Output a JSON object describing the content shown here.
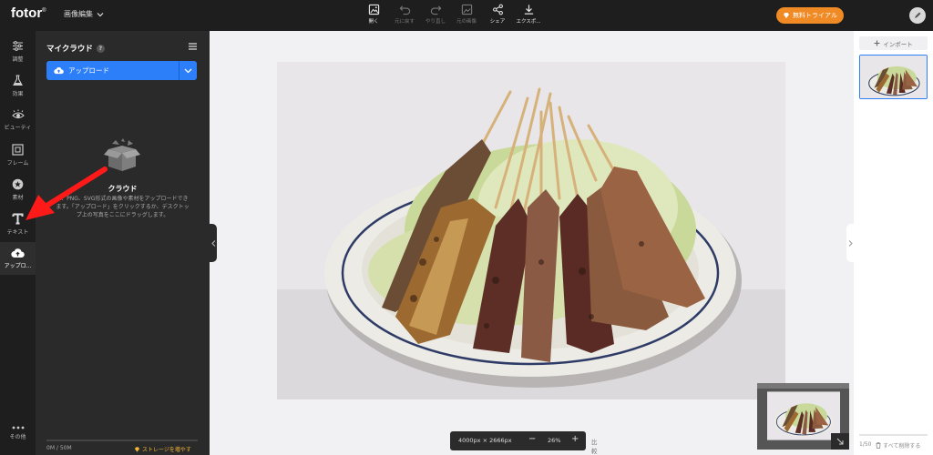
{
  "app": {
    "logo": "fotor",
    "logo_mark": "®",
    "mode_label": "画像編集",
    "trial_label": "無料トライアル"
  },
  "toolbar": [
    {
      "label": "開く",
      "icon": "image-open-icon",
      "enabled": true
    },
    {
      "label": "元に戻す",
      "icon": "undo-icon",
      "enabled": false
    },
    {
      "label": "やり直し",
      "icon": "redo-icon",
      "enabled": false
    },
    {
      "label": "元の画像",
      "icon": "original-image-icon",
      "enabled": false
    },
    {
      "label": "シェア",
      "icon": "share-icon",
      "enabled": true
    },
    {
      "label": "エクスポ...",
      "icon": "download-icon",
      "enabled": true
    }
  ],
  "sidebar": {
    "items": [
      {
        "label": "調整",
        "icon": "sliders-icon"
      },
      {
        "label": "効果",
        "icon": "flask-icon"
      },
      {
        "label": "ビューティ",
        "icon": "eye-icon"
      },
      {
        "label": "フレーム",
        "icon": "frame-icon"
      },
      {
        "label": "素材",
        "icon": "star-icon"
      },
      {
        "label": "テキスト",
        "icon": "text-icon"
      },
      {
        "label": "アップロ...",
        "icon": "cloud-upload-icon",
        "active": true
      }
    ],
    "more_label": "その他"
  },
  "panel": {
    "title": "マイクラウド",
    "help": "?",
    "upload_label": "アップロード",
    "cloud_title": "クラウド",
    "cloud_desc": "G、PNG、SVG形式の画像や素材をアップロードできます。「アップロード」をクリックするか、デスクトップ上の写真をここにドラッグします。",
    "storage_used": "0M / 50M",
    "storage_link": "ストレージを増やす"
  },
  "canvas": {
    "dimensions": "4000px × 2666px",
    "zoom_minus": "−",
    "zoom": "26%",
    "zoom_plus": "+",
    "ratio_label": "比較"
  },
  "right": {
    "import_label": "インポート",
    "page_count": "1/50",
    "delete_all": "すべて削除する"
  },
  "colors": {
    "accent": "#2d7ff9",
    "trial": "#f08a24",
    "annotation_arrow": "#ff1a1a"
  }
}
